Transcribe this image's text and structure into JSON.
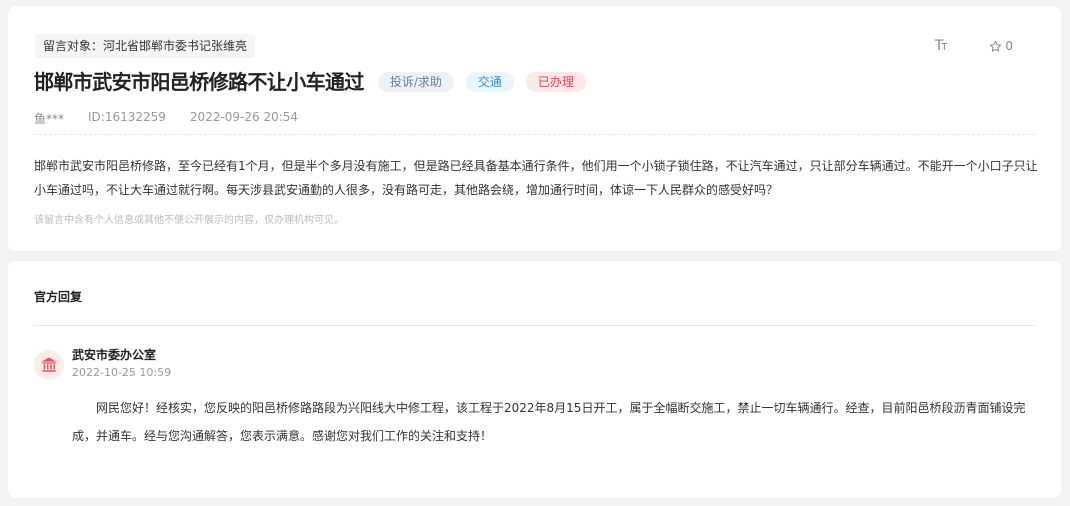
{
  "message": {
    "target": "留言对象：河北省邯郸市委书记张维亮",
    "title": "邯郸市武安市阳邑桥修路不让小车通过",
    "type": "投诉/求助",
    "category": "交通",
    "status": "已办理",
    "author": "鱼***",
    "id": "ID:16132259",
    "datetime": "2022-09-26 20:54",
    "content": "邯郸市武安市阳邑桥修路，至今已经有1个月，但是半个多月没有施工，但是路已经具备基本通行条件，他们用一个小锁子锁住路，不让汽车通过，只让部分车辆通过。不能开一个小口子只让小车通过吗，不让大车通过就行啊。每天涉县武安通勤的人很多，没有路可走，其他路会绕，增加通行时间，体谅一下人民群众的感受好吗？",
    "note": "该留言中含有个人信息或其他不便公开展示的内容，仅办理机构可见。"
  },
  "tools": {
    "font_size_icon": "font-size-icon",
    "favorite_count": "0"
  },
  "reply": {
    "header": "官方回复",
    "org": "武安市委办公室",
    "datetime": "2022-10-25 10:59",
    "content": "网民您好！经核实，您反映的阳邑桥修路路段为兴阳线大中修工程，该工程于2022年8月15日开工，属于全幅断交施工，禁止一切车辆通行。经查，目前阳邑桥段沥青面铺设完成，并通车。经与您沟通解答，您表示满意。感谢您对我们工作的关注和支持！"
  },
  "colors": {
    "status": "#e0434f",
    "category": "#3e8fc2",
    "type": "#6b7d99"
  }
}
